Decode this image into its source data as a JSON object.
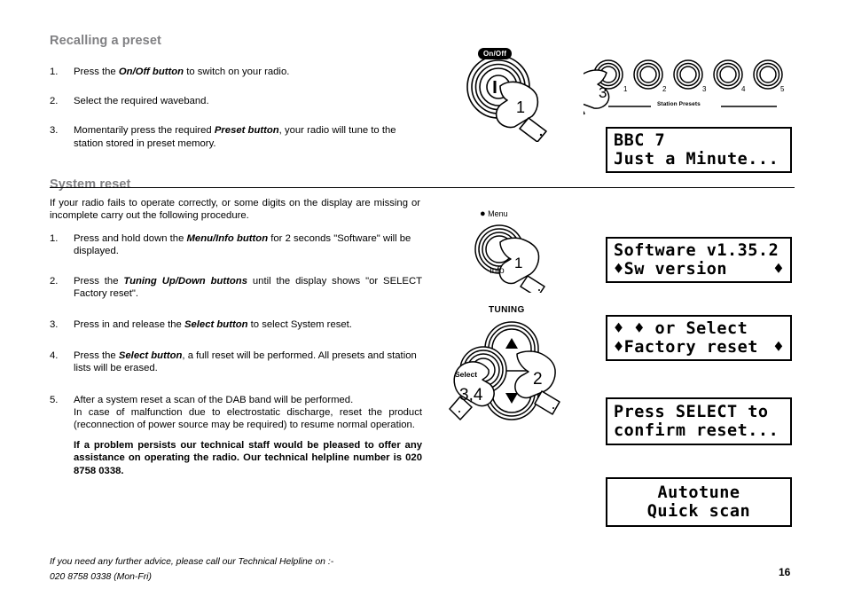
{
  "document": {
    "page_number": "16"
  },
  "sections": [
    {
      "id": "recalling",
      "heading": "Recalling a preset",
      "steps": [
        {
          "num": "1.",
          "html": "Press the <b class=\"bi\">On/Off button</b> to switch on your radio."
        },
        {
          "num": "2.",
          "html": "Select the required waveband."
        },
        {
          "num": "3.",
          "html": "Momentarily press the required <b class=\"bi\">Preset button</b>, your radio will tune to the station stored in preset memory."
        }
      ]
    },
    {
      "id": "system-reset",
      "heading": "System reset",
      "intro": "If your radio fails to operate correctly, or some digits on the display are missing or incomplete carry out the following procedure.",
      "steps": [
        {
          "num": "1.",
          "html": "Press and hold down the <b class=\"bi\">Menu/Info button</b> for 2 seconds \"Software\" will be displayed."
        },
        {
          "num": "2.",
          "html": "Press the <b class=\"bi\">Tuning Up/Down buttons</b> until the display shows \"or SELECT Factory reset\"."
        },
        {
          "num": "3.",
          "html": "Press in and release the <b class=\"bi\">Select button</b> to select System reset."
        },
        {
          "num": "4.",
          "html": "Press the <b class=\"bi\">Select button</b>, a full reset will be performed. All presets and station lists will be erased."
        },
        {
          "num": "5.",
          "html": "After a system reset a scan of the DAB band will be performed.<p class=\"just\">In case of malfunction due to electrostatic discharge, reset the product (reconnection of power source may be required) to resume normal operation.</p><p class=\"just\"><b>If a problem persists our technical staff would be pleased to offer any assistance on operating the radio. Our technical helpline number is 020 8758 0338.</b></p>"
        }
      ]
    }
  ],
  "footer": {
    "line1": "If you need any further advice, please call our Technical Helpline on :-",
    "line2": "020 8758 0338 (Mon-Fri)"
  },
  "illustrations": {
    "onoff_knob": {
      "label": "On/Off",
      "hand_number": "1"
    },
    "menu_knob": {
      "label_top": "Menu",
      "label_bottom": "Info",
      "hand_number": "1"
    },
    "tuning_control": {
      "title": "TUNING",
      "select_label": "Select",
      "hand_number_tuning": "2",
      "hand_number_select": "3,4",
      "up_arrow": "▲",
      "down_arrow": "▼"
    },
    "station_presets": {
      "caption": "Station Presets",
      "hand_number": "3",
      "buttons": [
        "1",
        "2",
        "3",
        "4",
        "5"
      ]
    }
  },
  "displays": [
    {
      "id": "display-bbc7",
      "line1": "BBC 7",
      "line2": "Just a Minute...",
      "align": "left"
    },
    {
      "id": "display-software",
      "line1": "Software v1.35.2",
      "line2_left": "♦Sw version",
      "line2_right": "♦",
      "align": "spread"
    },
    {
      "id": "display-factory-reset",
      "line1": "♦ ♦ or Select",
      "line2_left": "♦Factory reset",
      "line2_right": "♦",
      "align": "spread"
    },
    {
      "id": "display-confirm",
      "line1": "Press SELECT to",
      "line2": "confirm reset...",
      "align": "left"
    },
    {
      "id": "display-autotune",
      "line1": "Autotune",
      "line2": "Quick scan",
      "align": "center"
    }
  ],
  "colors": {
    "heading_gray": "#808083",
    "text_black": "#000000",
    "page_bg": "#ffffff"
  }
}
